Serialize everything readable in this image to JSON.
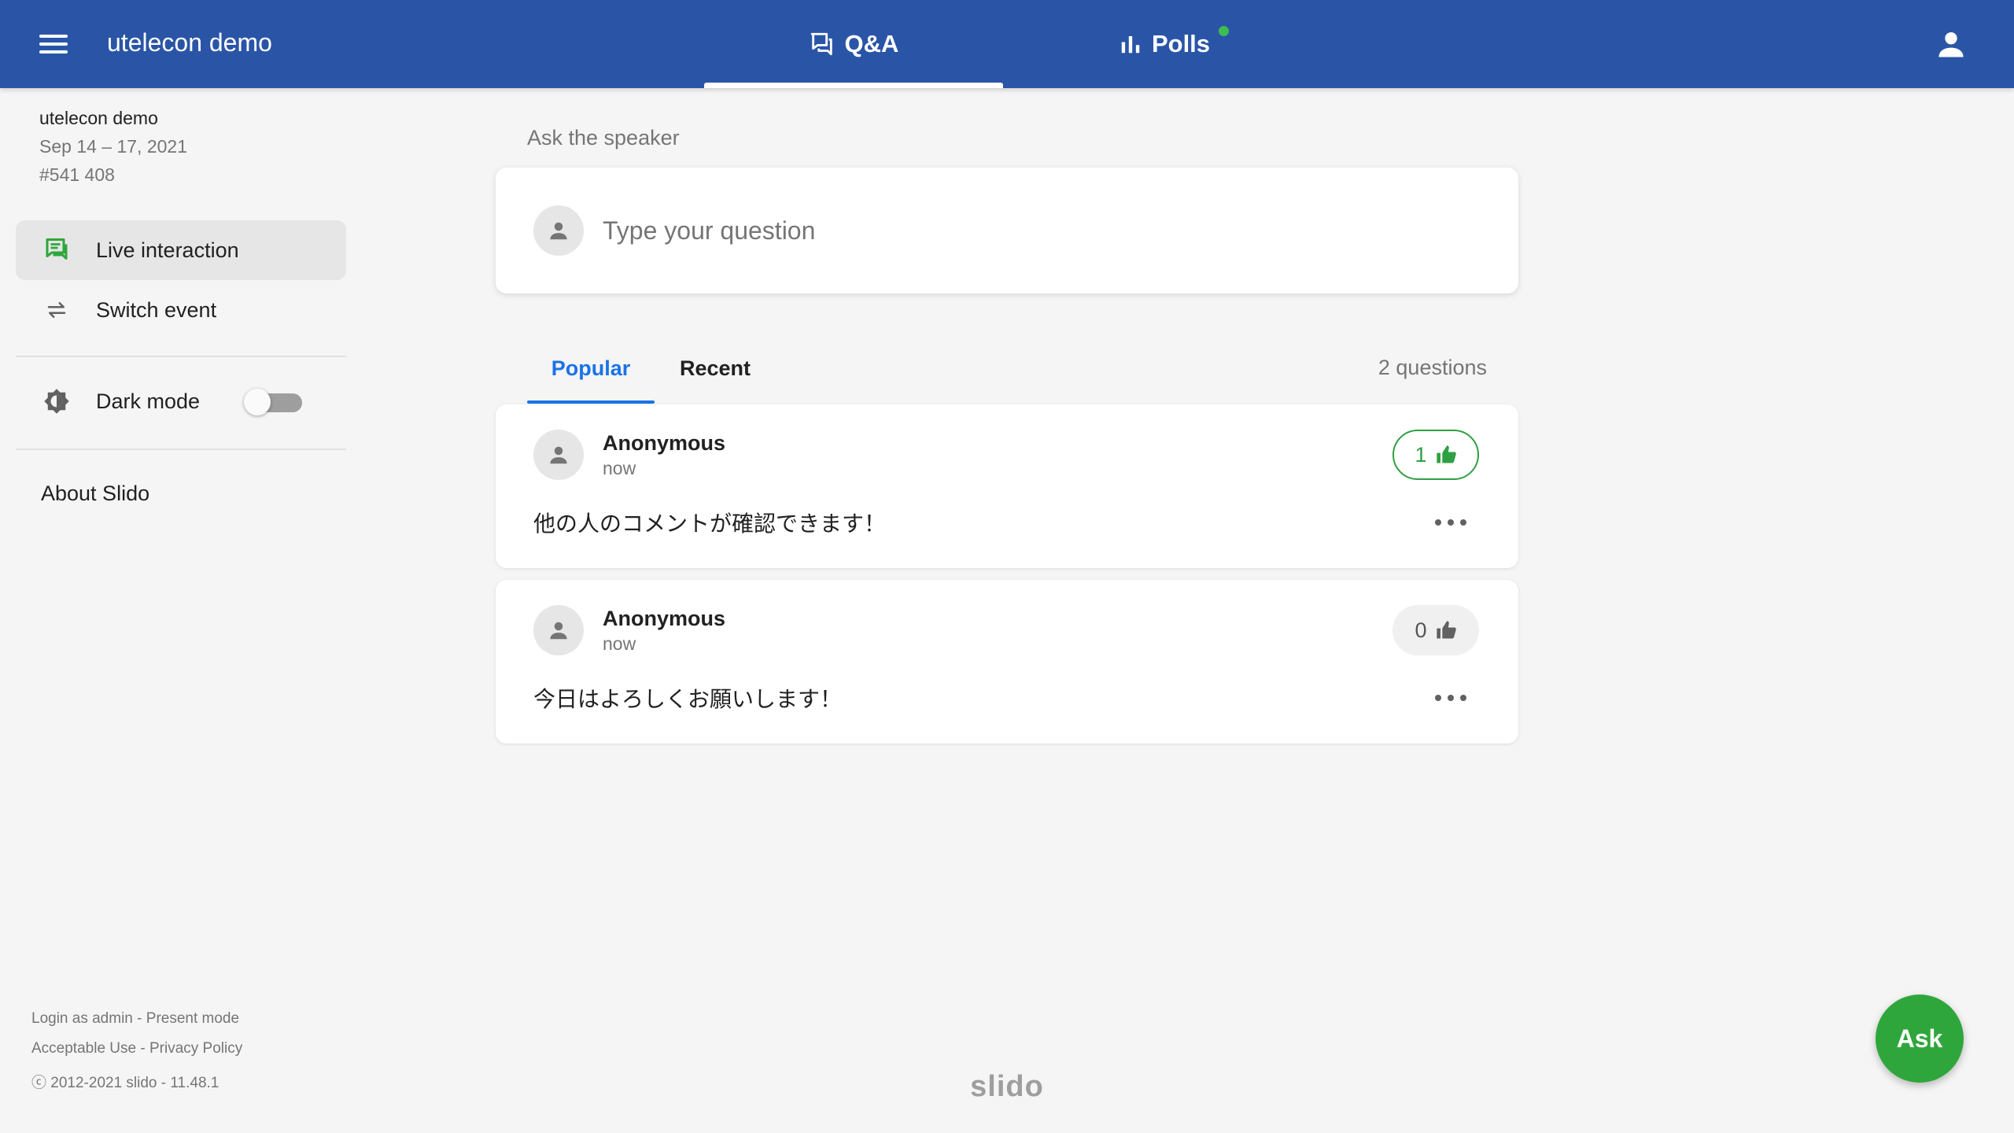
{
  "header": {
    "event_title": "utelecon demo",
    "tabs": [
      {
        "label": "Q&A",
        "icon": "chat-bubbles-icon",
        "active": true
      },
      {
        "label": "Polls",
        "icon": "bar-chart-icon",
        "active": false,
        "has_indicator": true
      }
    ],
    "colors": {
      "bar": "#2a55a7",
      "indicator": "#3dbd50"
    }
  },
  "sidebar": {
    "event_name": "utelecon demo",
    "event_dates": "Sep 14 – 17, 2021",
    "event_code": "#541 408",
    "items": [
      {
        "label": "Live interaction",
        "icon": "live-interaction-icon",
        "active": true
      },
      {
        "label": "Switch event",
        "icon": "switch-arrows-icon",
        "active": false
      }
    ],
    "dark_mode": {
      "label": "Dark mode",
      "enabled": false
    },
    "about_label": "About Slido",
    "footer": {
      "login_admin": "Login as admin",
      "present_mode": "Present mode",
      "acceptable_use": "Acceptable Use",
      "privacy_policy": "Privacy Policy",
      "copyright": "ⓒ 2012-2021 slido - 11.48.1",
      "separator": " - "
    }
  },
  "ask": {
    "label": "Ask the speaker",
    "placeholder": "Type your question"
  },
  "questions_tabs": {
    "popular": "Popular",
    "recent": "Recent",
    "count_label": "2 questions"
  },
  "questions": [
    {
      "author": "Anonymous",
      "time": "now",
      "text": "他の人のコメントが確認できます！",
      "likes": "1",
      "liked": true
    },
    {
      "author": "Anonymous",
      "time": "now",
      "text": "今日はよろしくお願いします！",
      "likes": "0",
      "liked": false
    }
  ],
  "brand": "slido",
  "fab": {
    "label": "Ask",
    "color": "#2fa63c"
  }
}
